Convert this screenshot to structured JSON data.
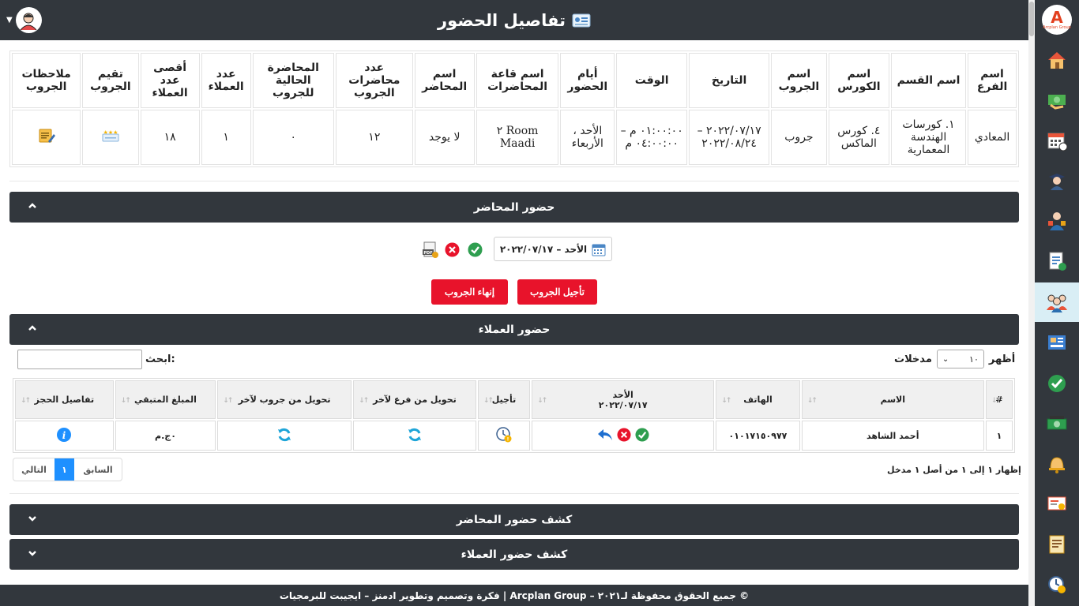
{
  "header": {
    "title": "تفاصيل الحضور"
  },
  "info_table": {
    "headers": [
      "اسم الفرع",
      "اسم القسم",
      "اسم الكورس",
      "اسم الجروب",
      "التاريخ",
      "الوقت",
      "أيام الحضور",
      "اسم قاعة المحاضرات",
      "اسم المحاضر",
      "عدد محاضرات الجروب",
      "المحاضرة الحالية للجروب",
      "عدد العملاء",
      "أقصى عدد العملاء",
      "تقيم الجروب",
      "ملاحظات الجروب"
    ],
    "values": [
      "المعادي",
      "١. كورسات الهندسة المعمارية",
      "٤. كورس الماكس",
      "جروب",
      "٢٠٢٢/٠٧/١٧ – ٢٠٢٢/٠٨/٢٤",
      "٠١:٠٠:٠٠ م – ٠٤:٠٠:٠٠ م",
      "الأحد ، الأربعاء",
      "Room ٢ Maadi",
      "لا يوجد",
      "١٢",
      "٠",
      "١",
      "١٨"
    ]
  },
  "instructor_section": {
    "title": "حضور المحاضر",
    "date": "الأحد – ٢٠٢٢/٠٧/١٧",
    "postpone_button": "تأجيل الجروب",
    "end_button": "إنهاء الجروب"
  },
  "clients_section": {
    "title": "حضور العملاء",
    "show_label": "أظهر",
    "entries_label": "مدخلات",
    "page_size": "١٠",
    "search_label": "ابحث:",
    "columns": [
      "#",
      "الاسم",
      "الهاتف",
      "الأحد",
      "٢٠٢٢/٠٧/١٧",
      "تأجيل",
      "تحويل من فرع لآخر",
      "تحويل من جروب لآخر",
      "المبلغ المتبقي",
      "تفاصيل الحجز"
    ],
    "rows": [
      {
        "num": "١",
        "name": "أحمد الشاهد",
        "phone": "٠١٠١٧١٥٠٩٧٧",
        "remaining": "٠ج.م"
      }
    ],
    "info_text": "إظهار ١ إلى ١ من أصل ١ مدخل",
    "prev_label": "السابق",
    "current_page": "١",
    "next_label": "التالي"
  },
  "instructor_report": {
    "title": "كشف حضور المحاضر"
  },
  "clients_report": {
    "title": "كشف حضور العملاء"
  },
  "footer": {
    "text": "© جميع الحقوق محفوظة لـ٢٠٢١ – Arcplan Group | فكرة وتصميم وتطوير ادمنز – ايجيبت للبرمجيات"
  },
  "sidebar": {
    "logo_letter": "A",
    "logo_text": "Arcplan Group",
    "items": [
      "home-icon",
      "payments-icon",
      "calendar-icon",
      "graduate-icon",
      "instructor-icon",
      "document-icon",
      "groups-icon",
      "board-icon",
      "attendance-icon",
      "cash-icon",
      "alarm-icon",
      "certificate-icon",
      "report-icon",
      "time-icon"
    ]
  },
  "colors": {
    "dark": "#32373d",
    "red": "#e8132b",
    "blue": "#1e90ff",
    "active": "#d9eef5"
  }
}
